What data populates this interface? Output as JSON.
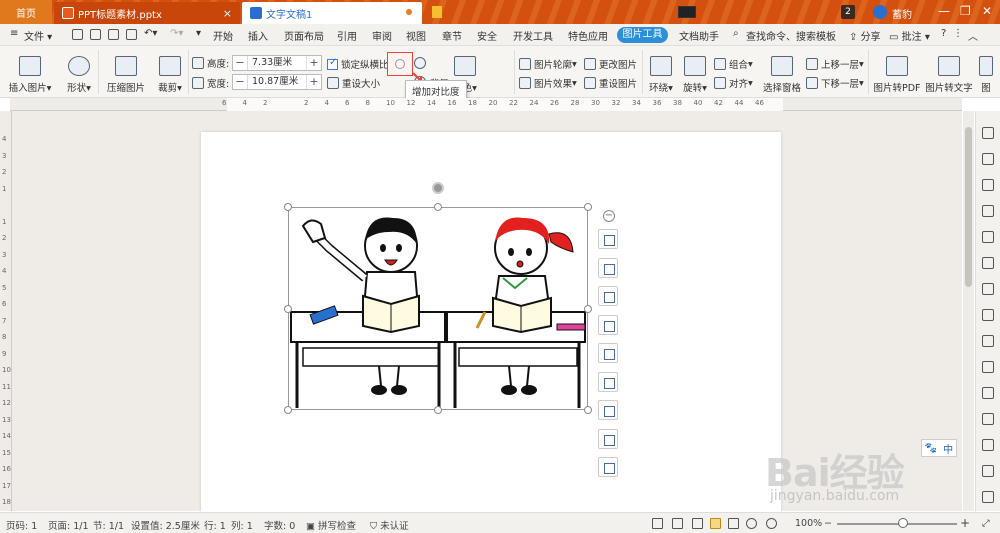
{
  "tabs": {
    "home": "首页",
    "ppt": "PPT标题素材.pptx",
    "doc": "文字文稿1"
  },
  "titlebar": {
    "badge": "2",
    "user": "蓄豹"
  },
  "menu": {
    "file": "文件",
    "items": [
      "开始",
      "插入",
      "页面布局",
      "引用",
      "审阅",
      "视图",
      "章节",
      "安全",
      "开发工具",
      "特色应用"
    ],
    "active": "图片工具",
    "doc_helper": "文档助手",
    "search": "查找命令、搜索模板",
    "share": "分享",
    "comment": "批注"
  },
  "ribbon": {
    "insert_picture": "插入图片",
    "shape": "形状",
    "compress": "压缩图片",
    "crop": "裁剪",
    "height_label": "高度:",
    "height_value": "7.33厘米",
    "width_label": "宽度:",
    "width_value": "10.87厘米",
    "lock_ratio": "锁定纵横比",
    "reset_size": "重设大小",
    "background": "背景",
    "color": "颜色",
    "picture_outline": "图片轮廓",
    "picture_effect": "图片效果",
    "change_picture": "更改图片",
    "reset_picture": "重设图片",
    "wrap": "环绕",
    "rotate": "旋转",
    "group": "组合",
    "align": "对齐",
    "selection_pane": "选择窗格",
    "bring_forward": "上移一层",
    "send_backward": "下移一层",
    "to_pdf": "图片转PDF",
    "to_text": "图片转文字",
    "more": "图"
  },
  "tooltip": "增加对比度",
  "ruler": {
    "h_ticks": [
      "6",
      "4",
      "2",
      "",
      "2",
      "4",
      "6",
      "8",
      "10",
      "12",
      "14",
      "16",
      "18",
      "20",
      "22",
      "24",
      "26",
      "28",
      "30",
      "32",
      "34",
      "36",
      "38",
      "40",
      "42",
      "44",
      "46"
    ],
    "v_ticks": [
      "4",
      "3",
      "2",
      "1",
      "",
      "1",
      "2",
      "3",
      "4",
      "5",
      "6",
      "7",
      "8",
      "9",
      "10",
      "11",
      "12",
      "13",
      "14",
      "15",
      "16",
      "17",
      "18"
    ]
  },
  "ime": "中",
  "watermark": {
    "main": "Bai经验",
    "sub": "jingyan.baidu.com"
  },
  "status": {
    "page_num": "页码: 1",
    "pages": "页面: 1/1",
    "section": "节: 1/1",
    "setting": "设置值: 2.5厘米",
    "row": "行: 1",
    "col": "列: 1",
    "words": "字数: 0",
    "spell": "拼写检查",
    "auth": "未认证",
    "zoom": "100%"
  },
  "colors": {
    "titlebar": "#d4500e",
    "accent": "#2c8fd8",
    "highlight_border": "#e8443a"
  }
}
